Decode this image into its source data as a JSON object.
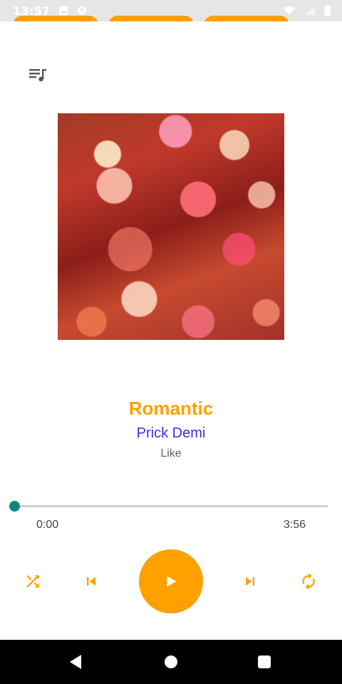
{
  "status_bar": {
    "time": "13:57",
    "icons_left": [
      "image-icon",
      "notification-icon"
    ],
    "icons_right": [
      "wifi-icon",
      "signal-icon",
      "battery-icon"
    ]
  },
  "toolbar": {
    "queue_icon": "queue-music-icon"
  },
  "song": {
    "title": "Romantic",
    "artist": "Prick Demi",
    "album": "Like"
  },
  "player": {
    "current_time": "0:00",
    "total_time": "3:56",
    "progress": 0.0,
    "controls": [
      "shuffle-icon",
      "previous-icon",
      "play-icon",
      "next-icon",
      "repeat-icon"
    ]
  },
  "colors": {
    "accent": "#FFA000",
    "artist": "#3333DD",
    "seek_thumb": "#00897B"
  },
  "nav_bar": [
    "back-icon",
    "home-icon",
    "recents-icon"
  ]
}
